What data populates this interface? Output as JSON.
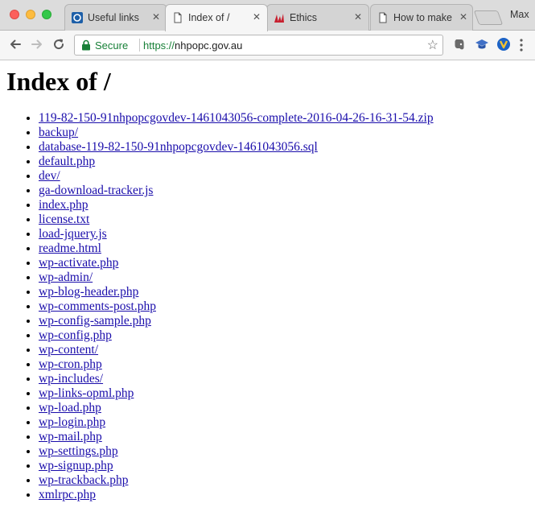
{
  "window": {
    "profile_name": "Max"
  },
  "tabs": [
    {
      "title": "Useful links",
      "icon": "blue-square-favicon",
      "close": "✕",
      "active": false
    },
    {
      "title": "Index of /",
      "icon": "document-icon",
      "close": "✕",
      "active": true
    },
    {
      "title": "Ethics",
      "icon": "red-logo-favicon",
      "close": "✕",
      "active": false
    },
    {
      "title": "How to make",
      "icon": "document-icon",
      "close": "✕",
      "active": false
    }
  ],
  "toolbar": {
    "secure_label": "Secure",
    "url_scheme": "https://",
    "url_host": "nhpopc.gov.au",
    "icons": [
      "back-arrow-icon",
      "forward-arrow-icon",
      "reload-icon",
      "lock-icon",
      "bookmark-star-icon",
      "evernote-icon",
      "extension-cap-icon",
      "extension-v-icon",
      "menu-dots-icon"
    ]
  },
  "page": {
    "title": "Index of /",
    "files": [
      "119-82-150-91nhpopcgovdev-1461043056-complete-2016-04-26-16-31-54.zip",
      "backup/",
      "database-119-82-150-91nhpopcgovdev-1461043056.sql",
      "default.php",
      "dev/",
      "ga-download-tracker.js",
      "index.php",
      "license.txt",
      "load-jquery.js",
      "readme.html",
      "wp-activate.php",
      "wp-admin/",
      "wp-blog-header.php",
      "wp-comments-post.php",
      "wp-config-sample.php",
      "wp-config.php",
      "wp-content/",
      "wp-cron.php",
      "wp-includes/",
      "wp-links-opml.php",
      "wp-load.php",
      "wp-login.php",
      "wp-mail.php",
      "wp-settings.php",
      "wp-signup.php",
      "wp-trackback.php",
      "xmlrpc.php"
    ]
  },
  "colors": {
    "link": "#1a0dab",
    "secure_green": "#188038"
  }
}
